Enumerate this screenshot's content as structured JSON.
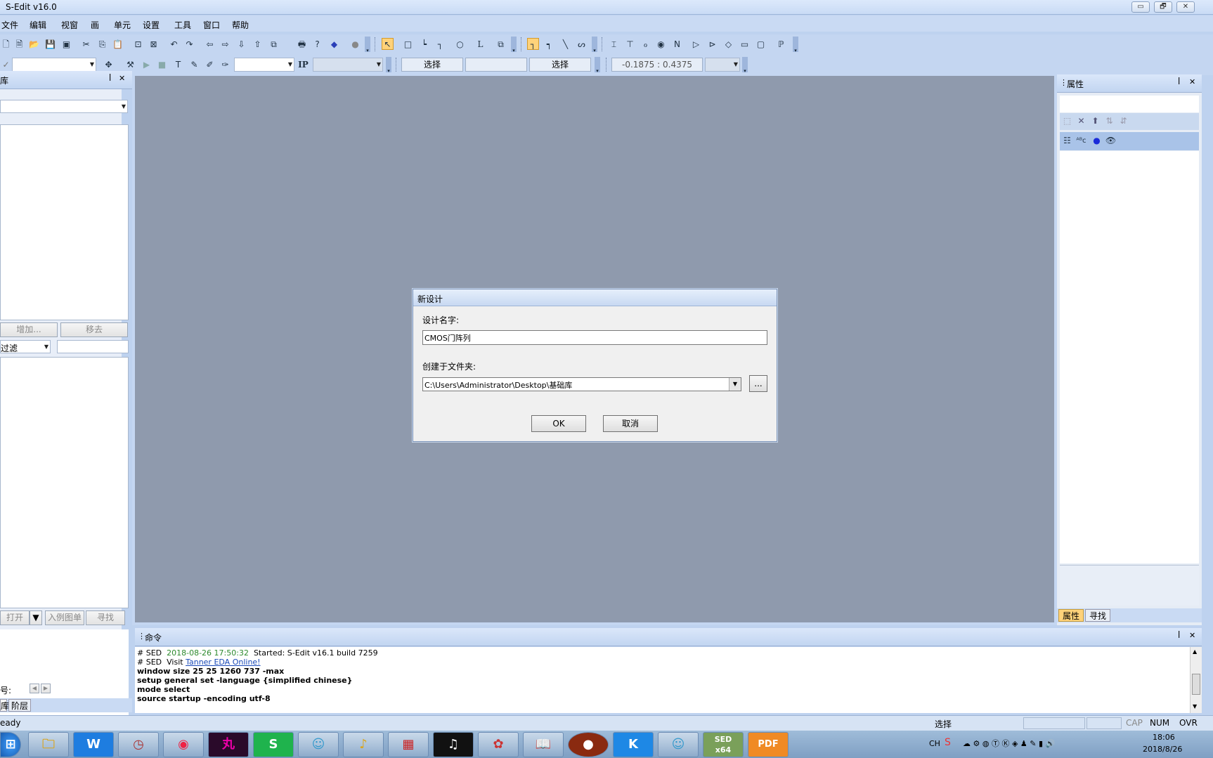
{
  "window": {
    "title": "S-Edit v16.0",
    "minimize": "▭",
    "restore": "🗗",
    "close": "✕"
  },
  "menu": [
    "文件",
    "编辑",
    "视窗",
    "画",
    "单元",
    "设置",
    "工具",
    "窗口",
    "帮助"
  ],
  "toolbar2": {
    "select_label_1": "选择",
    "select_label_2": "选择",
    "coords": "-0.1875 : 0.4375",
    "ip_label": "IP"
  },
  "library_pane": {
    "title": "库",
    "pin": "ꟾ",
    "close": "✕",
    "add_button": "增加...",
    "remove_button": "移去",
    "filter_label": "过滤",
    "open_button": "打开",
    "instance_button": "入例图单",
    "find_button": "寻找",
    "symbol_label": "号:",
    "tab_lib": "库",
    "tab_hier": "阶层"
  },
  "properties_pane": {
    "title": "属性",
    "tab_props": "属性",
    "tab_find": "寻找"
  },
  "dialog": {
    "title": "新设计",
    "name_label": "设计名字:",
    "name_value": "CMOS门阵列",
    "folder_label": "创建于文件夹:",
    "folder_value": "C:\\Users\\Administrator\\Desktop\\基础库",
    "browse_label": "...",
    "ok_label": "OK",
    "cancel_label": "取消"
  },
  "command_pane": {
    "title": "命令",
    "log": [
      {
        "prefix": "# SED",
        "stamp": "2018-08-26 17:50:32",
        "text": "Started: S-Edit v16.1 build 7259"
      },
      {
        "prefix": "# SED",
        "visit": "Visit",
        "link": "Tanner EDA Online!"
      },
      {
        "text": "window size 25 25 1260 737 -max"
      },
      {
        "text": "setup general set -language {simplified chinese}"
      },
      {
        "text": "mode select"
      },
      {
        "text": "source startup -encoding utf-8"
      }
    ]
  },
  "status": {
    "left": "eady",
    "mode": "选择",
    "cap": "CAP",
    "num": "NUM",
    "ovr": "OVR"
  },
  "taskbar": {
    "apps": [
      "start",
      "explorer",
      "wps",
      "clock",
      "chrome",
      "maruko",
      "green-s",
      "live2d",
      "golden",
      "gds",
      "winamp",
      "fan",
      "book",
      "bear",
      "kugou",
      "live2d-2",
      "sed-x64",
      "pdf"
    ],
    "sed_label": "SED",
    "sed_sub": "x64",
    "pdf_label": "PDF",
    "ime": "CH",
    "time": "18:06",
    "date": "2018/8/26"
  },
  "colors": {
    "canvas": "#8f9aad",
    "chrome": "#c4d6f1",
    "link": "#1a4ab8",
    "stamp": "#2d8a2d"
  }
}
